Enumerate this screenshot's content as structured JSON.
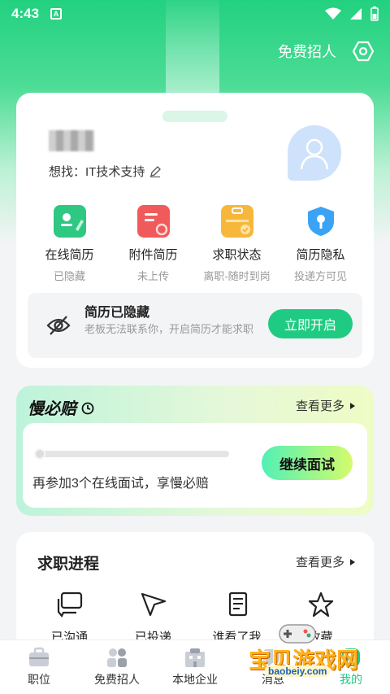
{
  "status_bar": {
    "time": "4:43",
    "app_badge": "A"
  },
  "top_bar": {
    "free_recruit_label": "免费招人"
  },
  "profile": {
    "seeking_label": "想找：IT技术支持"
  },
  "quick_actions": [
    {
      "label": "在线简历",
      "sub": "已隐藏",
      "color": "#2ec882",
      "icon": "online-resume-icon"
    },
    {
      "label": "附件简历",
      "sub": "未上传",
      "color": "#f05a5a",
      "icon": "attachment-resume-icon"
    },
    {
      "label": "求职状态",
      "sub": "离职-随时到岗",
      "color": "#f6b73c",
      "icon": "job-status-icon"
    },
    {
      "label": "简历隐私",
      "sub": "投递方可见",
      "color": "#3aa3f5",
      "icon": "resume-privacy-icon"
    }
  ],
  "resume_hidden": {
    "title": "简历已隐藏",
    "desc": "老板无法联系你，开启简历才能求职",
    "button": "立即开启"
  },
  "slow_compensation": {
    "title": "慢必赔",
    "more": "查看更多",
    "progress": 0,
    "text": "再参加3个在线面试，享慢必赔",
    "button": "继续面试"
  },
  "job_progress": {
    "title": "求职进程",
    "more": "查看更多",
    "items": [
      {
        "label": "已沟通",
        "icon": "chat-bubbles-icon"
      },
      {
        "label": "已投递",
        "icon": "send-cursor-icon"
      },
      {
        "label": "谁看了我",
        "icon": "document-icon"
      },
      {
        "label": "收藏",
        "icon": "star-icon"
      }
    ]
  },
  "tabbar": [
    {
      "label": "职位",
      "icon": "briefcase-icon",
      "active": false
    },
    {
      "label": "免费招人",
      "icon": "people-icon",
      "active": false
    },
    {
      "label": "本地企业",
      "icon": "building-icon",
      "active": false
    },
    {
      "label": "消息",
      "icon": "message-icon",
      "active": false
    },
    {
      "label": "我的",
      "icon": "me-icon",
      "active": true
    }
  ],
  "watermark": {
    "text": "宝贝游戏网",
    "url": "baobeiy.com"
  }
}
